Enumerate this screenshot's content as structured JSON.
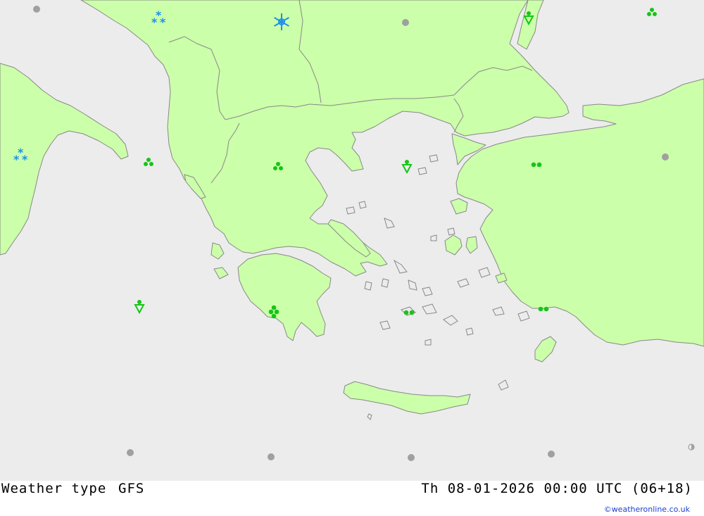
{
  "map": {
    "colors": {
      "sea": "#ececec",
      "land": "#ccffaa",
      "border": "#888888",
      "rain": "#16c516",
      "snow": "#1e90e8",
      "dry": "#a0a0a0"
    }
  },
  "symbols": [
    {
      "type": "dry",
      "icon": "dry-dot-icon"
    },
    {
      "type": "snow-showers",
      "icon": "snow-showers-icon"
    },
    {
      "type": "snow",
      "icon": "snowflake-icon"
    },
    {
      "type": "dry",
      "icon": "dry-dot-icon"
    },
    {
      "type": "rain-shower",
      "icon": "rain-shower-icon"
    },
    {
      "type": "heavy-rain",
      "icon": "heavy-rain-icon"
    },
    {
      "type": "snow-showers",
      "icon": "snow-showers-icon"
    },
    {
      "type": "heavy-rain",
      "icon": "heavy-rain-icon"
    },
    {
      "type": "heavy-rain",
      "icon": "heavy-rain-icon"
    },
    {
      "type": "rain-shower",
      "icon": "rain-shower-icon"
    },
    {
      "type": "rain",
      "icon": "rain-icon"
    },
    {
      "type": "dry",
      "icon": "dry-dot-icon"
    },
    {
      "type": "rain-shower",
      "icon": "rain-shower-icon"
    },
    {
      "type": "heavy-rain",
      "icon": "heavy-rain-icon"
    },
    {
      "type": "rain",
      "icon": "rain-icon"
    },
    {
      "type": "rain",
      "icon": "rain-icon"
    },
    {
      "type": "dry",
      "icon": "dry-dot-icon"
    },
    {
      "type": "dry",
      "icon": "dry-dot-icon"
    },
    {
      "type": "dry",
      "icon": "dry-dot-icon"
    },
    {
      "type": "dry",
      "icon": "dry-dot-icon"
    },
    {
      "type": "dry",
      "icon": "half-moon-icon"
    }
  ],
  "footer": {
    "title": "Weather type",
    "model": "GFS",
    "time": "Th 08-01-2026 00:00 UTC (06+18)",
    "credit": "©weatheronline.co.uk"
  }
}
